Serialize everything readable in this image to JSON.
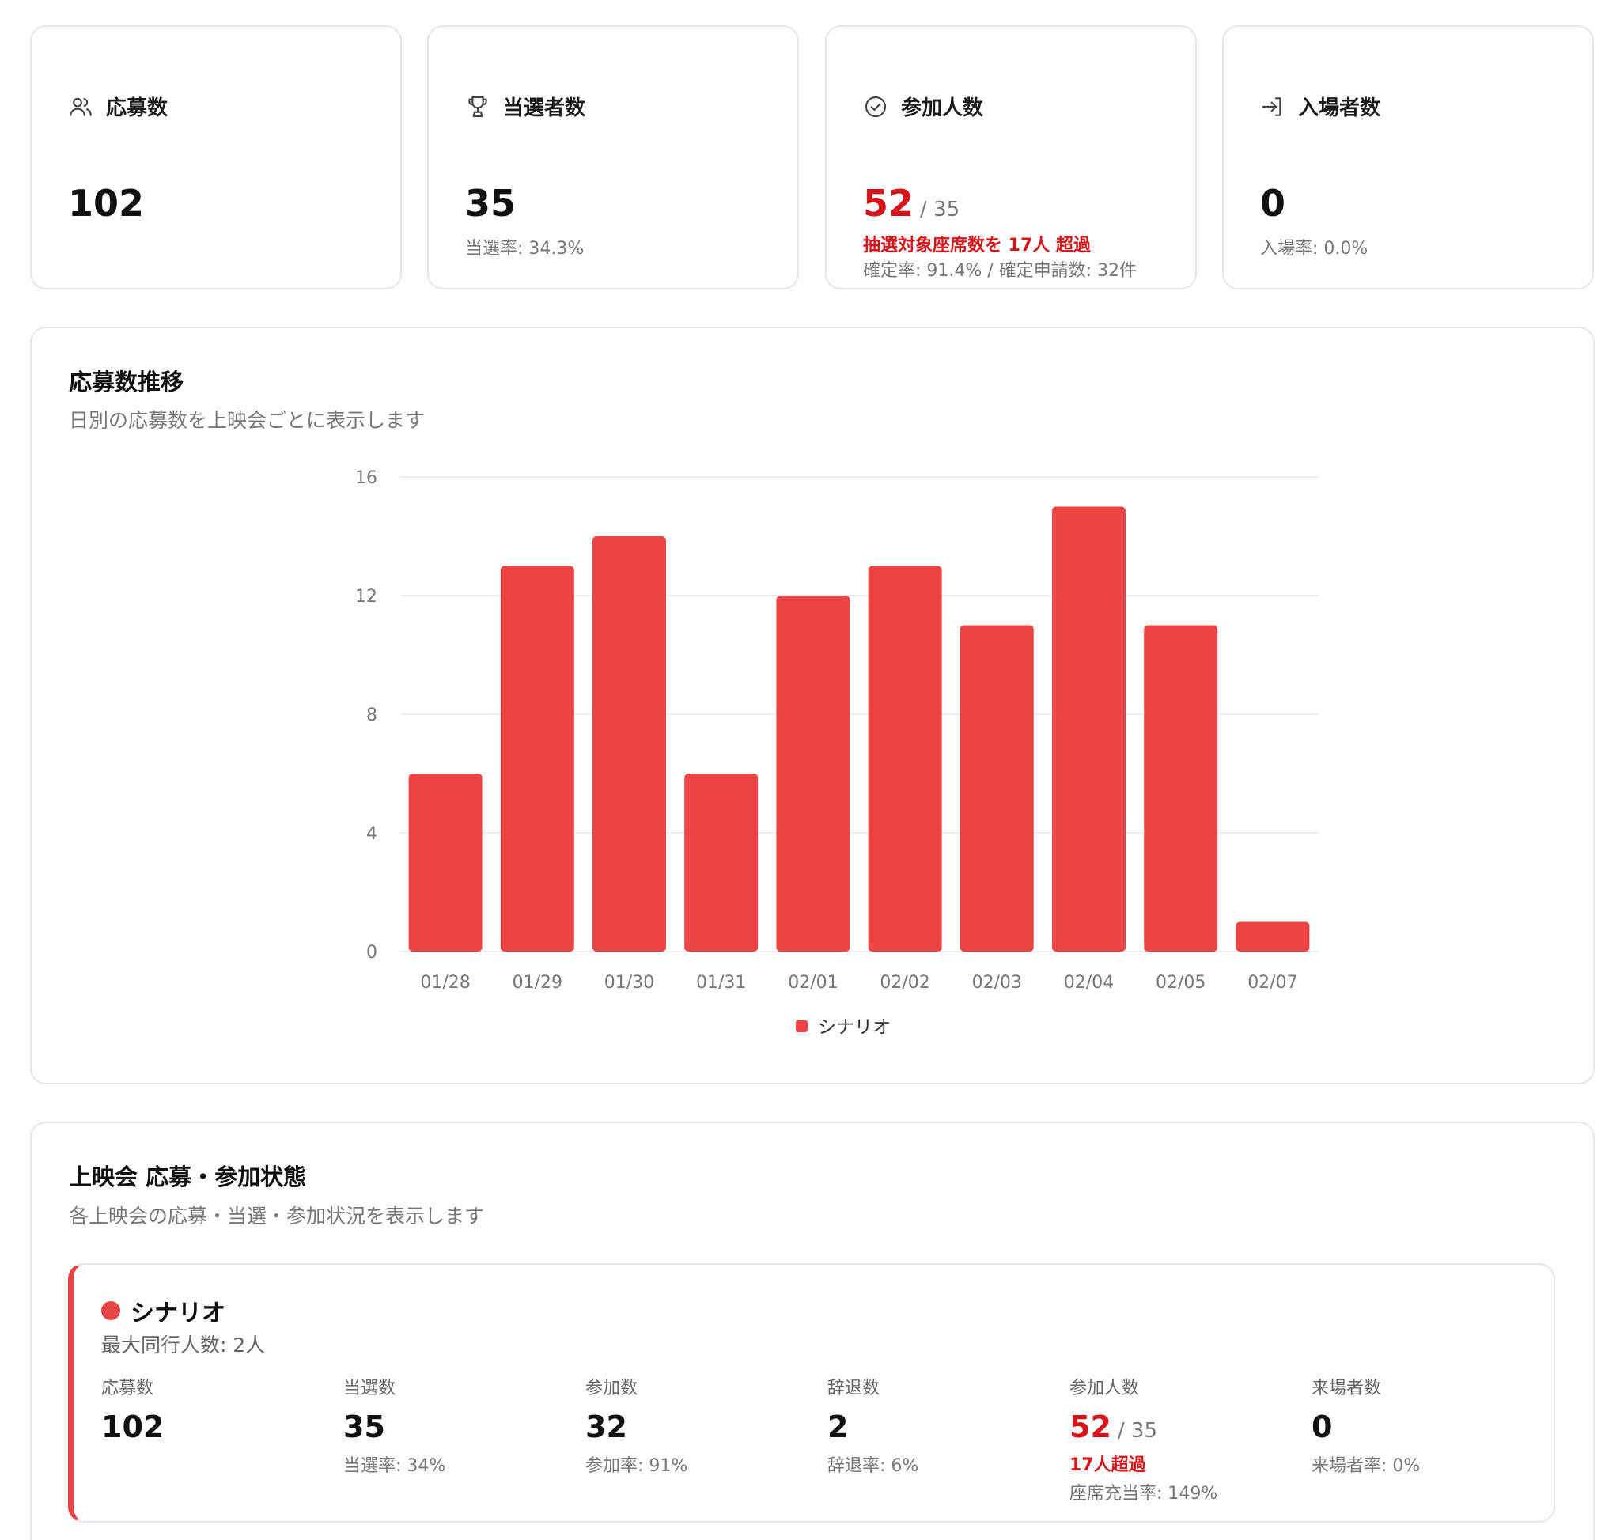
{
  "stats": [
    {
      "title": "応募数",
      "icon": "users-icon",
      "value": "102"
    },
    {
      "title": "当選者数",
      "icon": "trophy-icon",
      "value": "35",
      "sub": "当選率: 34.3%"
    },
    {
      "title": "参加人数",
      "icon": "check-circle-icon",
      "value": "52",
      "denom": "/ 35",
      "warn": "抽選対象座席数を 17人 超過",
      "sub": "確定率: 91.4% / 確定申請数: 32件"
    },
    {
      "title": "入場者数",
      "icon": "login-arrow-icon",
      "value": "0",
      "sub": "入場率: 0.0%"
    }
  ],
  "trend": {
    "title": "応募数推移",
    "description": "日別の応募数を上映会ごとに表示します"
  },
  "chart_data": {
    "type": "bar",
    "categories": [
      "01/28",
      "01/29",
      "01/30",
      "01/31",
      "02/01",
      "02/02",
      "02/03",
      "02/04",
      "02/05",
      "02/07"
    ],
    "series": [
      {
        "name": "シナリオ",
        "values": [
          6,
          13,
          14,
          6,
          12,
          13,
          11,
          15,
          11,
          1
        ],
        "color": "#ef4444"
      }
    ],
    "yticks": [
      "0",
      "4",
      "8",
      "12",
      "16"
    ],
    "ylim": [
      0,
      16
    ],
    "grid": true,
    "legend_position": "bottom-center"
  },
  "status": {
    "title": "上映会 応募・参加状態",
    "description": "各上映会の応募・当選・参加状況を表示します",
    "screening": {
      "name": "シナリオ",
      "accent": "#e64545",
      "max_companions": "最大同行人数: 2人",
      "metrics": [
        {
          "label": "応募数",
          "value": "102"
        },
        {
          "label": "当選数",
          "value": "35",
          "sub": "当選率: 34%"
        },
        {
          "label": "参加数",
          "value": "32",
          "sub": "参加率: 91%"
        },
        {
          "label": "辞退数",
          "value": "2",
          "sub": "辞退率: 6%"
        },
        {
          "label": "参加人数",
          "value": "52",
          "denom": "/ 35",
          "warn": "17人超過",
          "sub": "座席充当率: 149%"
        },
        {
          "label": "来場者数",
          "value": "0",
          "sub": "来場者率: 0%"
        }
      ]
    }
  }
}
